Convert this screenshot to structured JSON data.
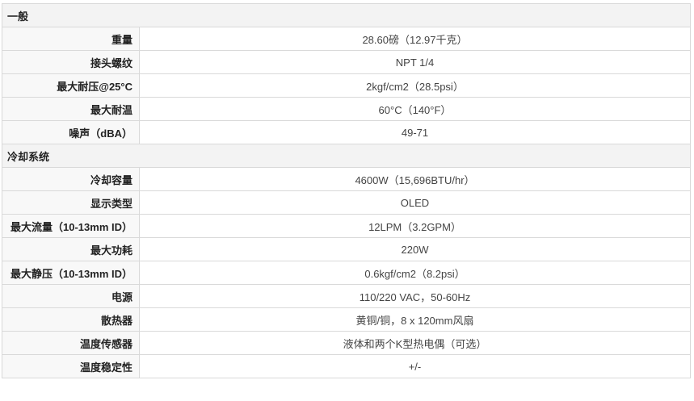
{
  "sections": [
    {
      "title": "一般",
      "rows": [
        {
          "label": "重量",
          "value": "28.60磅（12.97千克）"
        },
        {
          "label": "接头螺纹",
          "value": "NPT 1/4"
        },
        {
          "label": "最大耐压@25°C",
          "value": "2kgf/cm2（28.5psi）"
        },
        {
          "label": "最大耐温",
          "value": "60°C（140°F）"
        },
        {
          "label": "噪声（dBA）",
          "value": "49-71"
        }
      ]
    },
    {
      "title": "冷却系统",
      "rows": [
        {
          "label": "冷却容量",
          "value": "4600W（15,696BTU/hr）"
        },
        {
          "label": "显示类型",
          "value": "OLED"
        },
        {
          "label": "最大流量（10-13mm ID）",
          "value": "12LPM（3.2GPM）"
        },
        {
          "label": "最大功耗",
          "value": "220W"
        },
        {
          "label": "最大静压（10-13mm ID）",
          "value": "0.6kgf/cm2（8.2psi）"
        },
        {
          "label": "电源",
          "value": "110/220 VAC，50-60Hz"
        },
        {
          "label": "散热器",
          "value": "黄铜/铜，8 x 120mm风扇"
        },
        {
          "label": "温度传感器",
          "value": "液体和两个K型热电偶（可选）"
        },
        {
          "label": "温度稳定性",
          "value": "+/-"
        }
      ]
    }
  ]
}
